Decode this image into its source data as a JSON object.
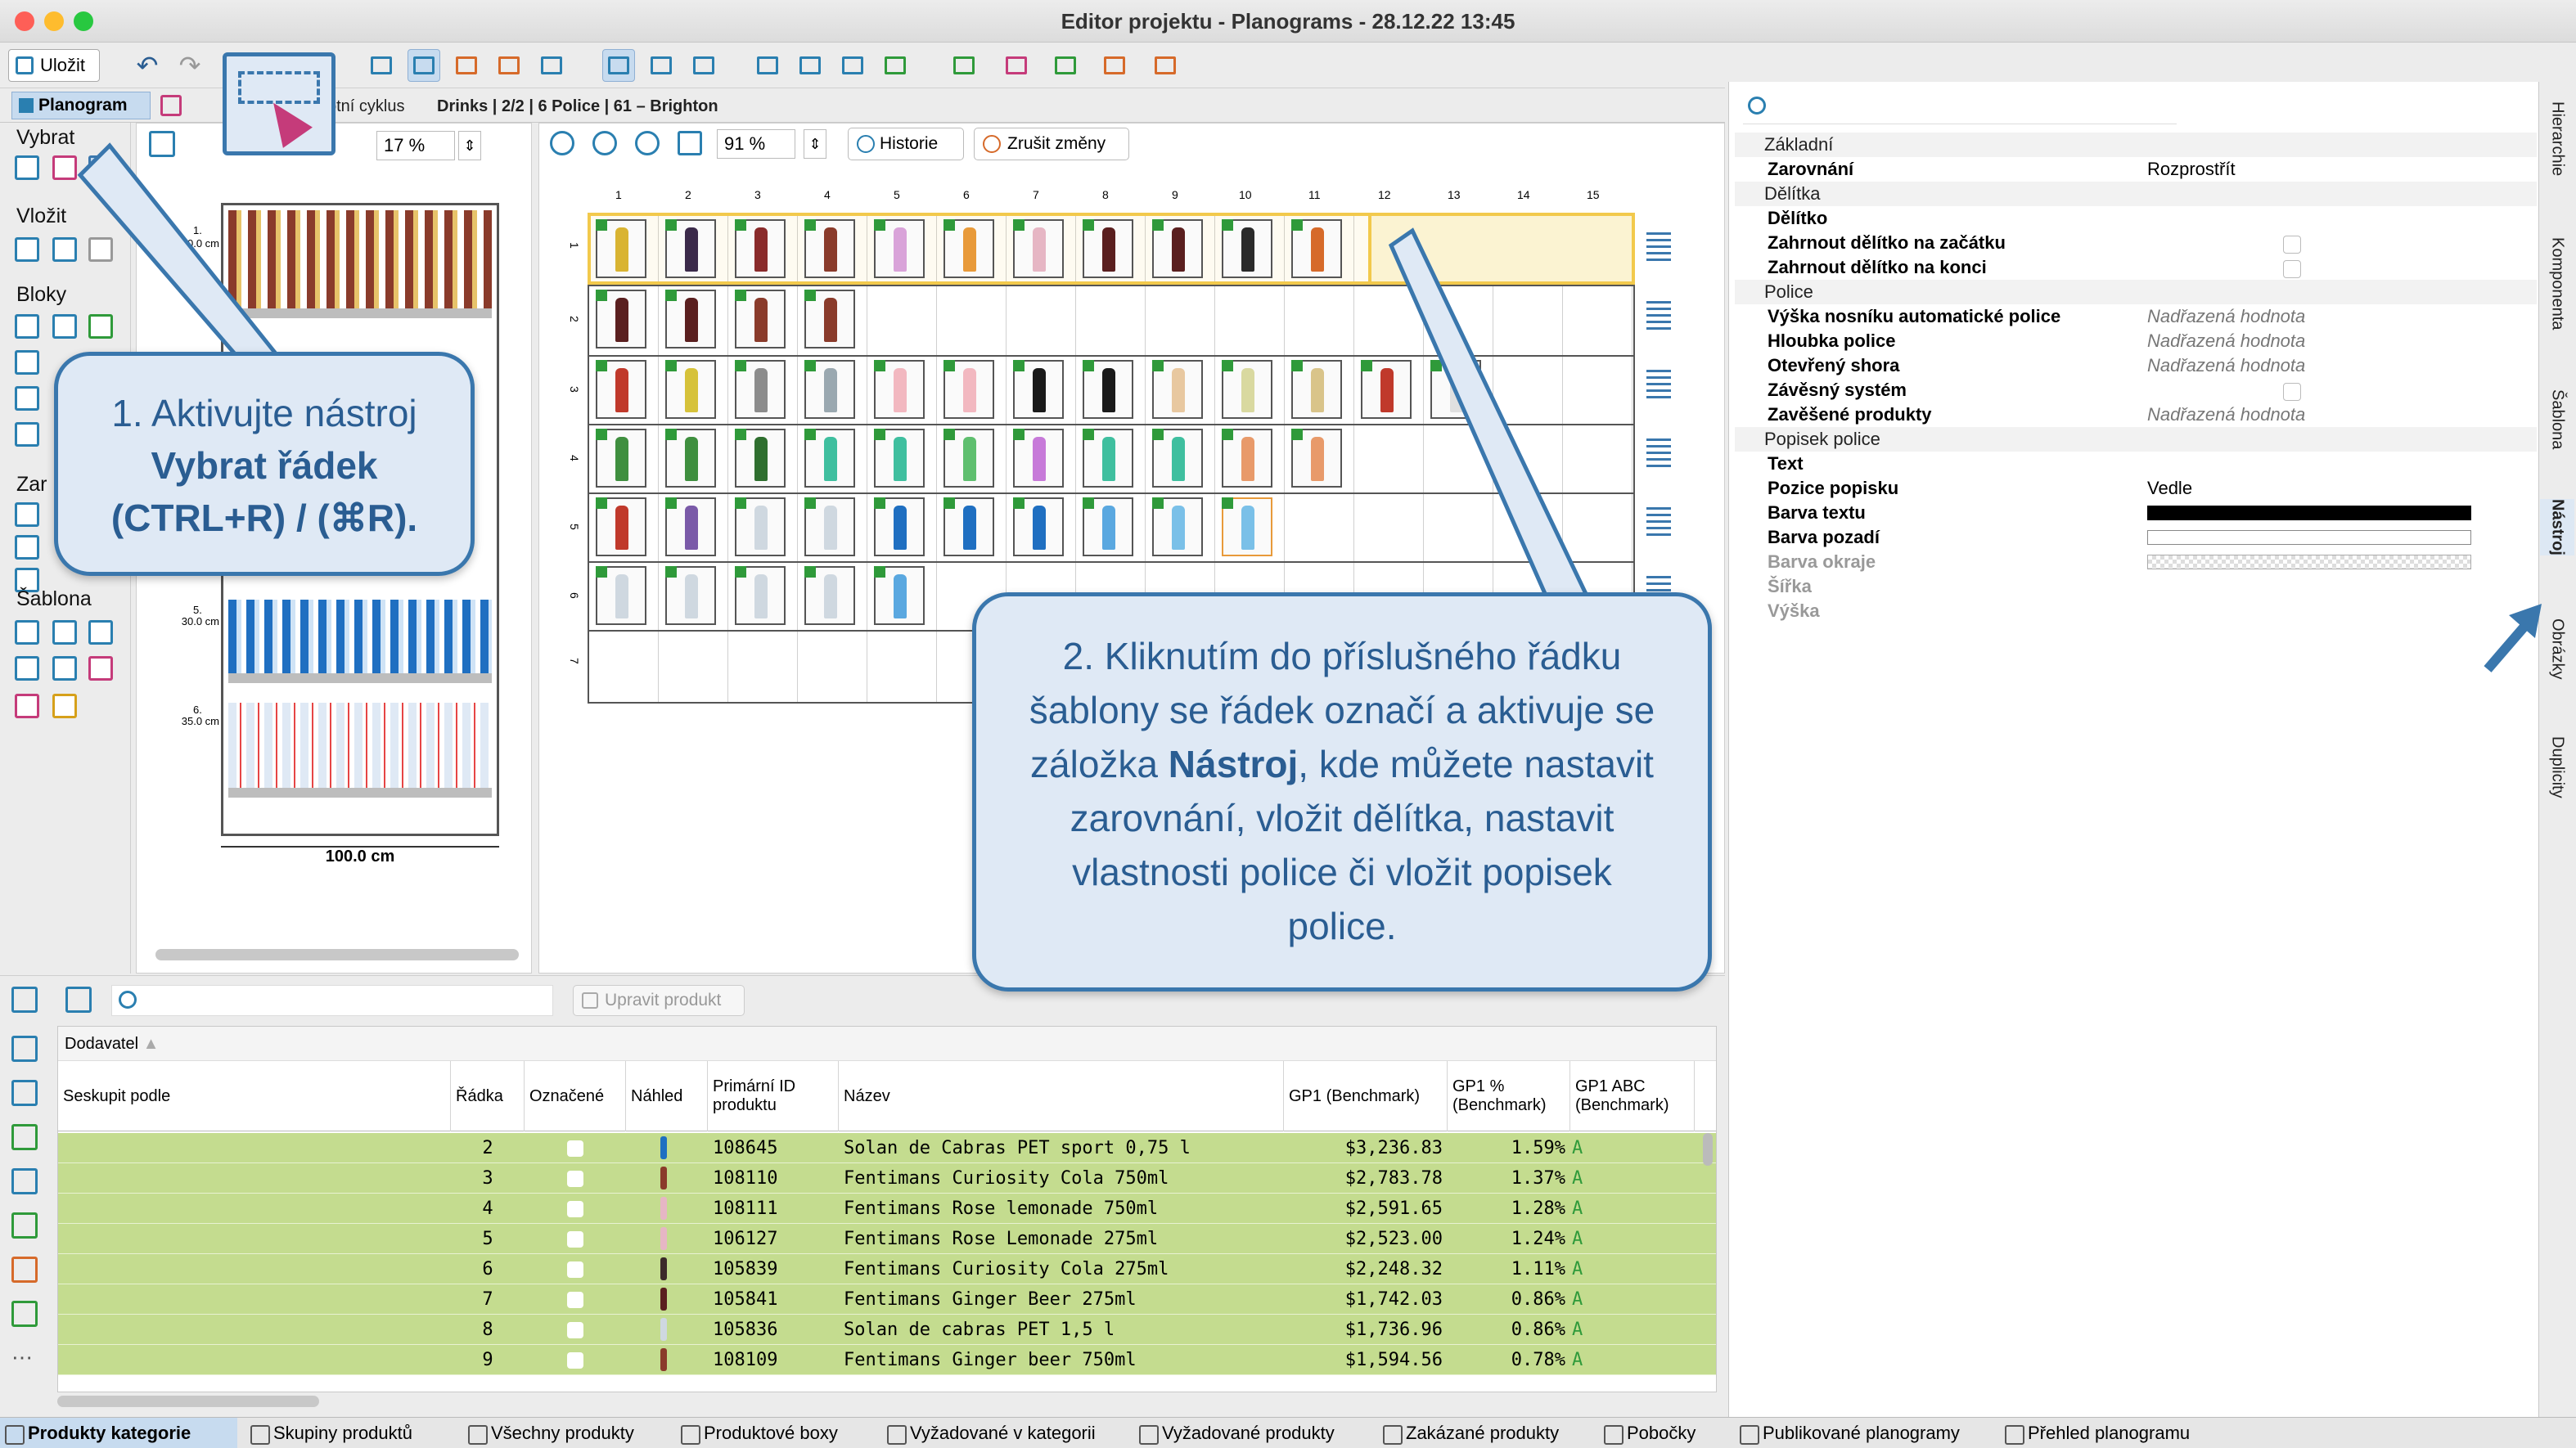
{
  "window": {
    "title": "Editor projektu - Planograms - 28.12.22 13:45"
  },
  "toolbar": {
    "save_label": "Uložit"
  },
  "tabs": {
    "active": "Planogram",
    "crumb1": "otní cyklus",
    "crumb2": "Drinks | 2/2 | 6 Police | 61 – Brighton"
  },
  "left": {
    "select": "Vybrat",
    "insert": "Vložit",
    "blocks": "Bloky",
    "zar": "Zar",
    "template": "Šablona"
  },
  "preview": {
    "zoom": "17 %",
    "width_label": "100.0 cm",
    "shelf_labels": [
      "30.0 cm",
      "30.0 cm",
      "35.0 cm"
    ],
    "shelf_nums": [
      "1.",
      "5.",
      "6."
    ]
  },
  "plan": {
    "zoom": "91 %",
    "history": "Historie",
    "cancel": "Zrušit změny",
    "columns": [
      "1",
      "2",
      "3",
      "4",
      "5",
      "6",
      "7",
      "8",
      "9",
      "10",
      "11",
      "12",
      "13",
      "14",
      "15"
    ],
    "rows": [
      "1",
      "2",
      "3",
      "4",
      "5",
      "6",
      "7"
    ]
  },
  "callout1": {
    "line1": "1. Aktivujte nástroj",
    "line2": "Vybrat řádek",
    "line3": "(CTRL+R) / (⌘R)."
  },
  "callout2": {
    "pre": "2. Kliknutím do příslušného řádku šablony se řádek označí a aktivuje se záložka ",
    "bold": "Nástroj",
    "post": ", kde můžete nastavit zarovnání, vložit dělítka, nastavit vlastnosti police či vložit popisek police."
  },
  "props": {
    "zakladni": "Základní",
    "zarovnani": "Zarovnání",
    "zarovnani_val": "Rozprostřít",
    "delitka": "Dělítka",
    "delitko": "Dělítko",
    "zac": "Zahrnout dělítko na začátku",
    "kon": "Zahrnout dělítko na konci",
    "police": "Police",
    "vyska_nos": "Výška nosníku automatické police",
    "hloubka": "Hloubka police",
    "otevreny": "Otevřený shora",
    "zavesny": "Závěsný systém",
    "zavesene": "Zavěšené produkty",
    "inherited": "Nadřazená hodnota",
    "popisek": "Popisek police",
    "text": "Text",
    "pozice": "Pozice popisku",
    "pozice_val": "Vedle",
    "barva_textu": "Barva textu",
    "barva_pozadi": "Barva pozadí",
    "barva_okraje": "Barva okraje",
    "sirka": "Šířka",
    "vyska": "Výška"
  },
  "righttabs": [
    "Hierarchie",
    "Komponenta",
    "Šablona",
    "Nástroj",
    "Obrázky",
    "Duplicity"
  ],
  "bottom": {
    "edit_product": "Upravit produkt",
    "group_header": "Dodavatel",
    "headers": {
      "group": "Seskupit podle",
      "row": "Řádka",
      "marked": "Označené",
      "preview": "Náhled",
      "id": "Primární ID produktu",
      "name": "Název",
      "gp1": "GP1 (Benchmark)",
      "gp1pct": "GP1 % (Benchmark)",
      "gp1abc": "GP1 ABC (Benchmark)"
    },
    "rows": [
      {
        "row": "2",
        "id": "108645",
        "name": "Solan de Cabras PET sport 0,75 l",
        "gp1": "$3,236.83",
        "pct": "1.59%",
        "abc": "A"
      },
      {
        "row": "3",
        "id": "108110",
        "name": "Fentimans Curiosity Cola 750ml",
        "gp1": "$2,783.78",
        "pct": "1.37%",
        "abc": "A"
      },
      {
        "row": "4",
        "id": "108111",
        "name": "Fentimans Rose lemonade 750ml",
        "gp1": "$2,591.65",
        "pct": "1.28%",
        "abc": "A"
      },
      {
        "row": "5",
        "id": "106127",
        "name": "Fentimans Rose Lemonade 275ml",
        "gp1": "$2,523.00",
        "pct": "1.24%",
        "abc": "A"
      },
      {
        "row": "6",
        "id": "105839",
        "name": "Fentimans Curiosity Cola 275ml",
        "gp1": "$2,248.32",
        "pct": "1.11%",
        "abc": "A"
      },
      {
        "row": "7",
        "id": "105841",
        "name": "Fentimans Ginger Beer 275ml",
        "gp1": "$1,742.03",
        "pct": "0.86%",
        "abc": "A"
      },
      {
        "row": "8",
        "id": "105836",
        "name": "Solan de cabras PET 1,5 l",
        "gp1": "$1,736.96",
        "pct": "0.86%",
        "abc": "A"
      },
      {
        "row": "9",
        "id": "108109",
        "name": "Fentimans Ginger beer 750ml",
        "gp1": "$1,594.56",
        "pct": "0.78%",
        "abc": "A"
      }
    ]
  },
  "statusbar": [
    "Produkty kategorie",
    "Skupiny produktů",
    "Všechny produkty",
    "Produktové boxy",
    "Vyžadované v kategorii",
    "Vyžadované produkty",
    "Zakázané produkty",
    "Pobočky",
    "Publikované planogramy",
    "Přehled planogramu"
  ],
  "colors": {
    "accent": "#3a77ad",
    "row_green": "#c4dc8f",
    "select_yellow": "#f2c94c"
  }
}
